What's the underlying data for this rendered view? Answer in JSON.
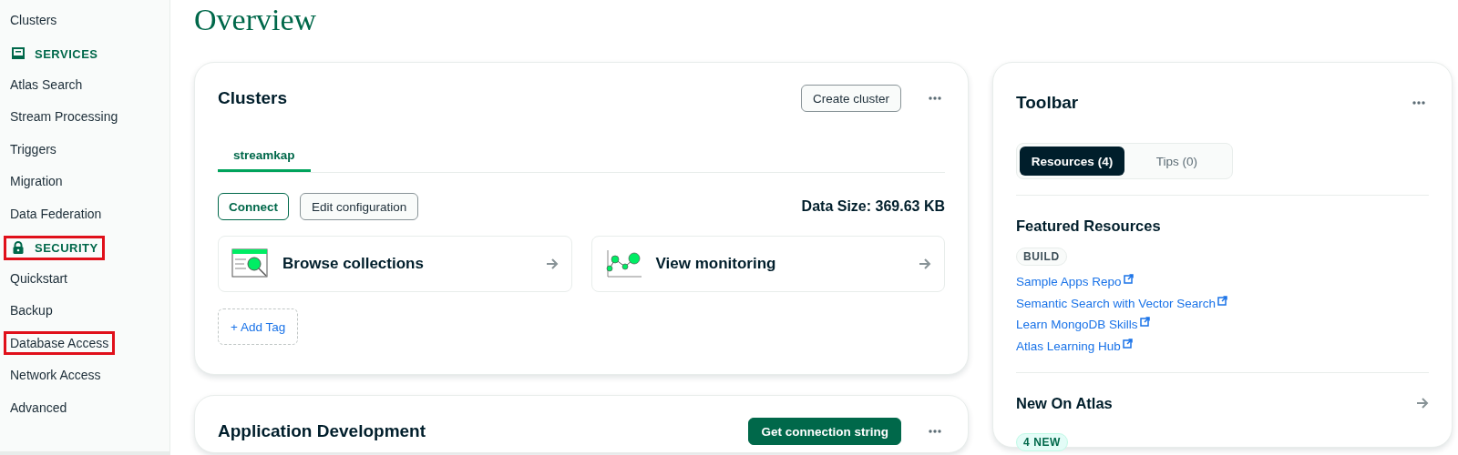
{
  "sidebar": {
    "items": [
      {
        "kind": "link",
        "label": "Clusters",
        "highlighted": false
      },
      {
        "kind": "section",
        "label": "SERVICES",
        "highlighted": false
      },
      {
        "kind": "link",
        "label": "Atlas Search",
        "highlighted": false
      },
      {
        "kind": "link",
        "label": "Stream Processing",
        "highlighted": false
      },
      {
        "kind": "link",
        "label": "Triggers",
        "highlighted": false
      },
      {
        "kind": "link",
        "label": "Migration",
        "highlighted": false
      },
      {
        "kind": "link",
        "label": "Data Federation",
        "highlighted": false
      },
      {
        "kind": "section",
        "label": "SECURITY",
        "highlighted": true
      },
      {
        "kind": "link",
        "label": "Quickstart",
        "highlighted": false
      },
      {
        "kind": "link",
        "label": "Backup",
        "highlighted": false
      },
      {
        "kind": "link",
        "label": "Database Access",
        "highlighted": true
      },
      {
        "kind": "link",
        "label": "Network Access",
        "highlighted": false
      },
      {
        "kind": "link",
        "label": "Advanced",
        "highlighted": false
      }
    ]
  },
  "page_title": "Overview",
  "clusters_card": {
    "title": "Clusters",
    "create_button": "Create cluster",
    "tabs": [
      {
        "label": "streamkap",
        "selected": true
      }
    ],
    "buttons": [
      {
        "kind": "outline",
        "label": "Connect"
      },
      {
        "kind": "plain",
        "label": "Edit configuration"
      }
    ],
    "data_size": "Data Size: 369.63 KB",
    "tiles": [
      {
        "label": "Browse collections"
      },
      {
        "label": "View monitoring"
      }
    ],
    "add_tag": "+ Add Tag"
  },
  "app_dev_card": {
    "title": "Application Development",
    "button": "Get connection string"
  },
  "toolbar_card": {
    "title": "Toolbar",
    "segments": [
      {
        "label": "Resources (4)",
        "selected": true
      },
      {
        "label": "Tips (0)",
        "selected": false
      }
    ],
    "featured": {
      "title": "Featured Resources",
      "badge": "BUILD",
      "links": [
        "Sample Apps Repo",
        "Semantic Search with Vector Search",
        "Learn MongoDB Skills",
        "Atlas Learning Hub"
      ]
    },
    "new_on_atlas": {
      "title": "New On Atlas",
      "badge": "4 NEW"
    }
  }
}
